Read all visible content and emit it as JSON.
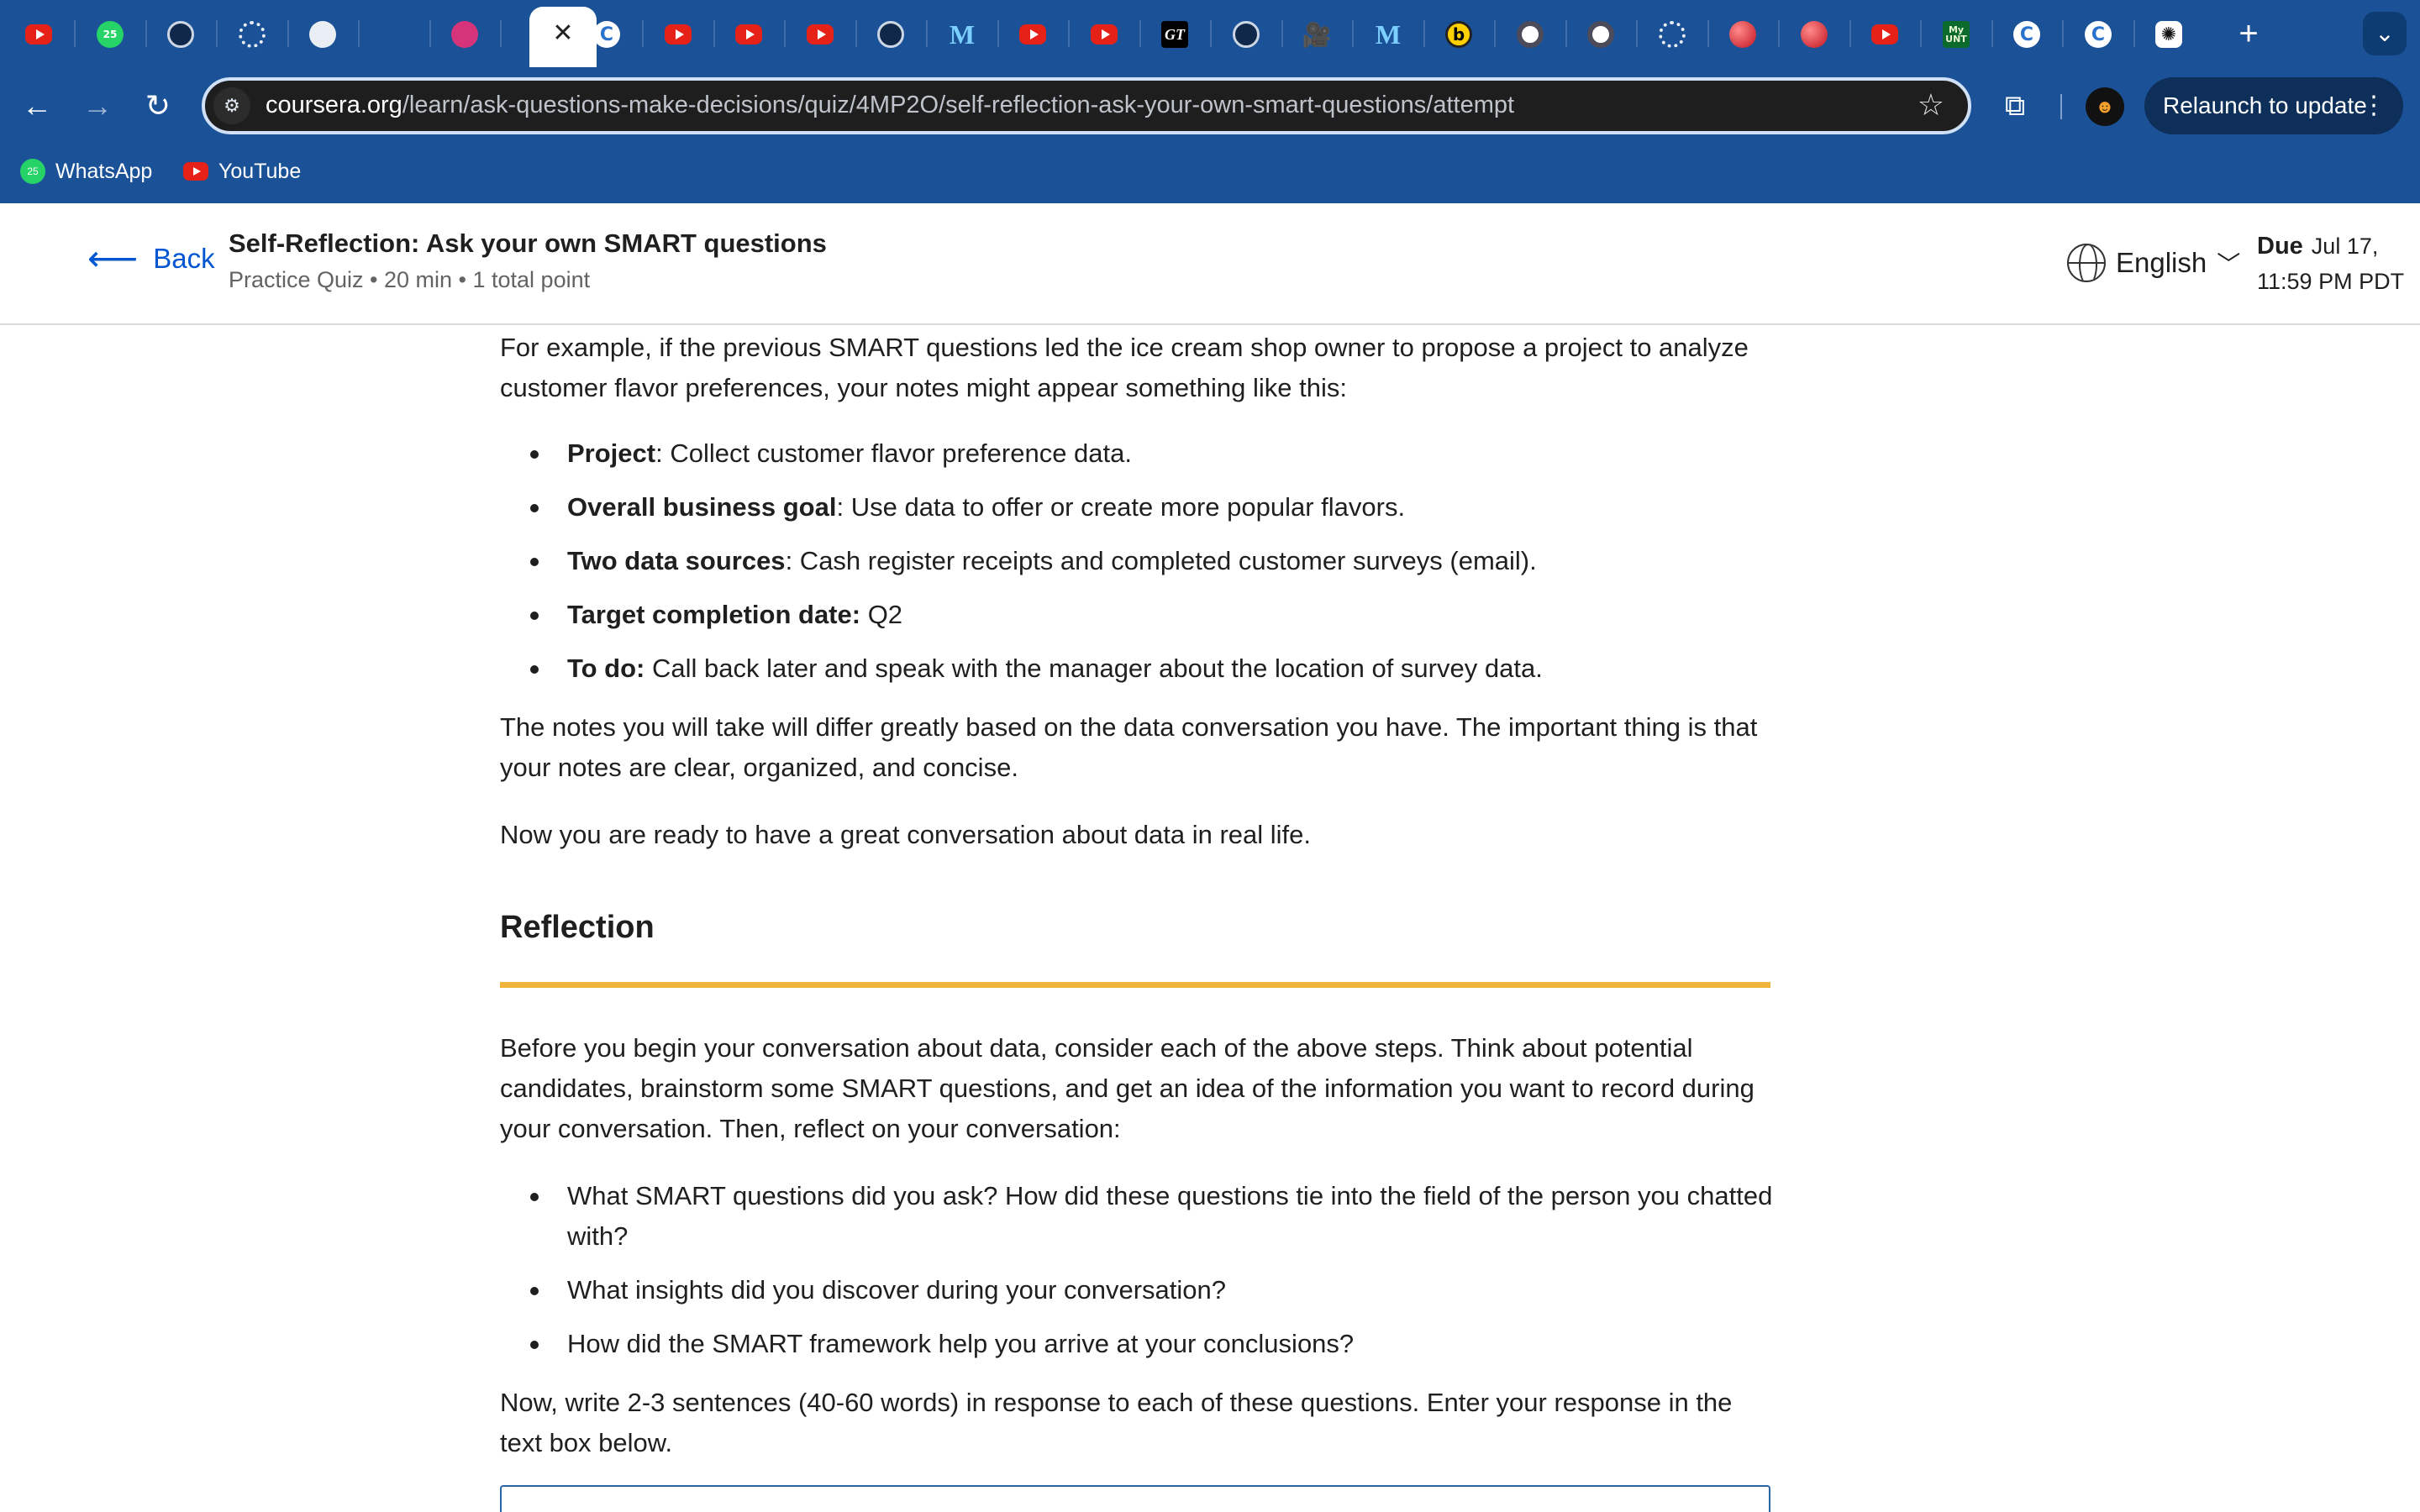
{
  "browser": {
    "tabs": [
      {
        "icon": "youtube-icon",
        "label": ""
      },
      {
        "icon": "whatsapp-icon",
        "label": "25"
      },
      {
        "icon": "openai-icon",
        "label": ""
      },
      {
        "icon": "loading-ring-icon",
        "label": ""
      },
      {
        "icon": "github-icon",
        "label": ""
      },
      {
        "icon": "play-triangle-icon",
        "label": ""
      },
      {
        "icon": "pink-circle-icon",
        "label": ""
      },
      {
        "icon": "close-icon",
        "label": "✕",
        "active": true
      },
      {
        "icon": "coursera-icon",
        "label": "C"
      },
      {
        "icon": "youtube-icon",
        "label": ""
      },
      {
        "icon": "youtube-icon",
        "label": ""
      },
      {
        "icon": "youtube-icon",
        "label": ""
      },
      {
        "icon": "compass-icon",
        "label": ""
      },
      {
        "icon": "m-logo-icon",
        "label": "M"
      },
      {
        "icon": "youtube-icon",
        "label": ""
      },
      {
        "icon": "youtube-icon",
        "label": ""
      },
      {
        "icon": "gt-logo-icon",
        "label": "GT"
      },
      {
        "icon": "openai-icon",
        "label": ""
      },
      {
        "icon": "video-camera-icon",
        "label": "🎥"
      },
      {
        "icon": "m-logo-icon",
        "label": "M"
      },
      {
        "icon": "b-logo-icon",
        "label": "b"
      },
      {
        "icon": "target-icon",
        "label": ""
      },
      {
        "icon": "target-icon",
        "label": ""
      },
      {
        "icon": "loading-ring-icon",
        "label": ""
      },
      {
        "icon": "red-ball-icon",
        "label": ""
      },
      {
        "icon": "red-ball-icon",
        "label": ""
      },
      {
        "icon": "youtube-icon",
        "label": ""
      },
      {
        "icon": "my-unt-icon",
        "label": "My UNT"
      },
      {
        "icon": "coursera-icon",
        "label": "C"
      },
      {
        "icon": "coursera-icon",
        "label": "C"
      },
      {
        "icon": "chatgpt-icon",
        "label": "✺"
      }
    ],
    "new_tab_label": "+",
    "tab_menu_label": "⌄",
    "url_host": "coursera.org",
    "url_path": "/learn/ask-questions-make-decisions/quiz/4MP2O/self-reflection-ask-your-own-smart-questions/attempt",
    "relaunch_label": "Relaunch to update",
    "bookmarks": [
      {
        "label": "WhatsApp",
        "badge": "25"
      },
      {
        "label": "YouTube"
      }
    ]
  },
  "header": {
    "back_label": "Back",
    "title": "Self-Reflection: Ask your own SMART questions",
    "meta": "Practice Quiz • 20 min • 1 total point",
    "language": "English",
    "due_label": "Due",
    "due_date_line1": "Jul 17,",
    "due_date_line2": "11:59 PM PDT"
  },
  "content": {
    "intro": "For example, if the previous SMART questions led the ice cream shop owner to propose a project to analyze customer flavor preferences, your notes might appear something like this:",
    "notes": [
      {
        "term": "Project",
        "sep": ":",
        "text": " Collect customer flavor preference data."
      },
      {
        "term": "Overall business goal",
        "sep": ":",
        "text": " Use data to offer or create more popular flavors."
      },
      {
        "term": "Two data sources",
        "sep": ":",
        "text": " Cash register receipts and completed customer surveys (email)."
      },
      {
        "term": "Target completion date:",
        "sep": "",
        "text": " Q2"
      },
      {
        "term": "To do:",
        "sep": "",
        "text": " Call back later and speak with the manager about the location of survey data."
      }
    ],
    "notes_paragraph": "The notes you will take will differ greatly based on the data conversation you have. The important thing is that your notes are clear, organized, and concise.",
    "ready_paragraph": "Now you are ready to have a great conversation about data in real life.",
    "reflection_heading": "Reflection",
    "reflection_intro": "Before you begin your conversation about data, consider each of the above steps. Think about potential candidates, brainstorm some SMART questions, and get an idea of the information you want to record during your conversation. Then, reflect on your conversation:",
    "questions": [
      "What SMART questions did you ask? How did these questions tie into the field of the person you chatted with?",
      "What insights did you discover during your conversation?",
      "How did the SMART framework help you arrive at your conclusions?"
    ],
    "instructions": "Now, write 2-3 sentences (40-60 words) in response to each of these questions. Enter your response in the text box below."
  },
  "colors": {
    "chrome": "#1b5297",
    "link": "#0056d2",
    "accent_rule": "#f0b43a"
  }
}
